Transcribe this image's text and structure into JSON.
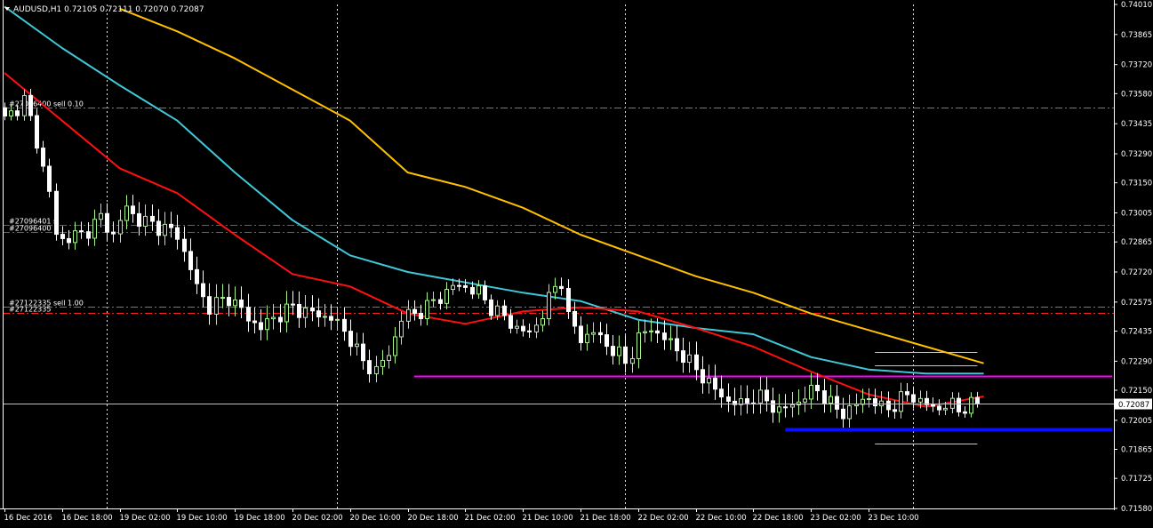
{
  "chart_data": {
    "type": "candlestick",
    "symbol_header": "AUDUSD,H1  0.72105 0.72111 0.72070 0.72087",
    "current_price": 0.72087,
    "current_price_label": "0.72087",
    "ylim": [
      0.7158,
      0.7401
    ],
    "y_ticks": [
      "0.74010",
      "0.73865",
      "0.73720",
      "0.73580",
      "0.73435",
      "0.73290",
      "0.73150",
      "0.73005",
      "0.72865",
      "0.72720",
      "0.72575",
      "0.72435",
      "0.72290",
      "0.72150",
      "0.72005",
      "0.71865",
      "0.71725",
      "0.71580"
    ],
    "x_range": [
      0,
      163
    ],
    "x_ticks": [
      {
        "i": 0,
        "label": "16 Dec 2016"
      },
      {
        "i": 9,
        "label": "16 Dec 18:00"
      },
      {
        "i": 18,
        "label": "19 Dec 02:00"
      },
      {
        "i": 27,
        "label": "19 Dec 10:00"
      },
      {
        "i": 36,
        "label": "19 Dec 18:00"
      },
      {
        "i": 45,
        "label": "20 Dec 02:00"
      },
      {
        "i": 54,
        "label": "20 Dec 10:00"
      },
      {
        "i": 63,
        "label": "20 Dec 18:00"
      },
      {
        "i": 72,
        "label": "21 Dec 02:00"
      },
      {
        "i": 81,
        "label": "21 Dec 10:00"
      },
      {
        "i": 90,
        "label": "21 Dec 18:00"
      },
      {
        "i": 99,
        "label": "22 Dec 02:00"
      },
      {
        "i": 108,
        "label": "22 Dec 10:00"
      },
      {
        "i": 117,
        "label": "22 Dec 18:00"
      },
      {
        "i": 126,
        "label": "23 Dec 02:00"
      },
      {
        "i": 135,
        "label": "23 Dec 10:00"
      }
    ],
    "period_separators": [
      16,
      52,
      97,
      142
    ],
    "close_anchors": [
      [
        0,
        0.7345
      ],
      [
        3,
        0.7355
      ],
      [
        5,
        0.7335
      ],
      [
        7,
        0.731
      ],
      [
        8,
        0.729
      ],
      [
        9,
        0.7288
      ],
      [
        12,
        0.729
      ],
      [
        15,
        0.7298
      ],
      [
        17,
        0.729
      ],
      [
        19,
        0.7303
      ],
      [
        21,
        0.7297
      ],
      [
        23,
        0.7295
      ],
      [
        25,
        0.7293
      ],
      [
        27,
        0.729
      ],
      [
        30,
        0.7265
      ],
      [
        32,
        0.7255
      ],
      [
        35,
        0.726
      ],
      [
        38,
        0.725
      ],
      [
        40,
        0.7245
      ],
      [
        42,
        0.725
      ],
      [
        45,
        0.7255
      ],
      [
        48,
        0.7252
      ],
      [
        51,
        0.725
      ],
      [
        54,
        0.724
      ],
      [
        56,
        0.7228
      ],
      [
        58,
        0.7225
      ],
      [
        60,
        0.7232
      ],
      [
        62,
        0.725
      ],
      [
        64,
        0.7252
      ],
      [
        66,
        0.7255
      ],
      [
        68,
        0.726
      ],
      [
        70,
        0.7265
      ],
      [
        72,
        0.7265
      ],
      [
        74,
        0.7262
      ],
      [
        76,
        0.7255
      ],
      [
        78,
        0.725
      ],
      [
        80,
        0.7245
      ],
      [
        82,
        0.7242
      ],
      [
        84,
        0.7252
      ],
      [
        86,
        0.7265
      ],
      [
        87,
        0.7268
      ],
      [
        88,
        0.725
      ],
      [
        90,
        0.724
      ],
      [
        92,
        0.7243
      ],
      [
        94,
        0.7237
      ],
      [
        96,
        0.7232
      ],
      [
        97,
        0.7228
      ],
      [
        99,
        0.724
      ],
      [
        101,
        0.7245
      ],
      [
        103,
        0.724
      ],
      [
        105,
        0.7235
      ],
      [
        107,
        0.7228
      ],
      [
        109,
        0.7222
      ],
      [
        111,
        0.7215
      ],
      [
        113,
        0.721
      ],
      [
        115,
        0.7208
      ],
      [
        117,
        0.7212
      ],
      [
        119,
        0.721
      ],
      [
        121,
        0.7205
      ],
      [
        123,
        0.7208
      ],
      [
        125,
        0.7212
      ],
      [
        127,
        0.7216
      ],
      [
        129,
        0.7208
      ],
      [
        131,
        0.7204
      ],
      [
        133,
        0.7208
      ],
      [
        135,
        0.7212
      ],
      [
        137,
        0.7206
      ],
      [
        139,
        0.7208
      ],
      [
        141,
        0.7213
      ],
      [
        143,
        0.721
      ],
      [
        145,
        0.7206
      ],
      [
        147,
        0.7208
      ],
      [
        149,
        0.7206
      ],
      [
        151,
        0.7208
      ],
      [
        152,
        0.72087
      ]
    ],
    "ma_series": [
      {
        "color": "#ffc000",
        "points": [
          [
            18,
            0.7399
          ],
          [
            27,
            0.7388
          ],
          [
            36,
            0.7375
          ],
          [
            45,
            0.736
          ],
          [
            54,
            0.7345
          ],
          [
            63,
            0.732
          ],
          [
            72,
            0.7313
          ],
          [
            81,
            0.7303
          ],
          [
            90,
            0.729
          ],
          [
            99,
            0.728
          ],
          [
            108,
            0.727
          ],
          [
            117,
            0.7262
          ],
          [
            126,
            0.7252
          ],
          [
            135,
            0.7244
          ],
          [
            144,
            0.7236
          ],
          [
            153,
            0.7228
          ]
        ]
      },
      {
        "color": "#40c8d8",
        "points": [
          [
            0,
            0.74
          ],
          [
            9,
            0.738
          ],
          [
            18,
            0.7362
          ],
          [
            27,
            0.7345
          ],
          [
            36,
            0.732
          ],
          [
            45,
            0.7297
          ],
          [
            54,
            0.728
          ],
          [
            63,
            0.7272
          ],
          [
            72,
            0.7267
          ],
          [
            81,
            0.7262
          ],
          [
            90,
            0.7258
          ],
          [
            99,
            0.7249
          ],
          [
            108,
            0.7245
          ],
          [
            117,
            0.7242
          ],
          [
            126,
            0.7231
          ],
          [
            135,
            0.7225
          ],
          [
            144,
            0.7223
          ],
          [
            153,
            0.7223
          ]
        ]
      },
      {
        "color": "#ff1010",
        "points": [
          [
            0,
            0.7368
          ],
          [
            9,
            0.7345
          ],
          [
            18,
            0.7322
          ],
          [
            27,
            0.731
          ],
          [
            36,
            0.729
          ],
          [
            45,
            0.7271
          ],
          [
            54,
            0.7265
          ],
          [
            63,
            0.7252
          ],
          [
            72,
            0.7247
          ],
          [
            81,
            0.7253
          ],
          [
            90,
            0.7255
          ],
          [
            99,
            0.7253
          ],
          [
            108,
            0.7245
          ],
          [
            117,
            0.7236
          ],
          [
            126,
            0.7224
          ],
          [
            135,
            0.7213
          ],
          [
            144,
            0.7207
          ],
          [
            153,
            0.7212
          ]
        ]
      }
    ],
    "order_lines": [
      {
        "price": 0.73513,
        "color": "#1fb534",
        "dash": "8,3,2,3",
        "label": "#27096400 sell 0.10"
      },
      {
        "price": 0.72948,
        "color": "#ff2020",
        "dash": "8,3,2,3",
        "label": "#27096401 s"
      },
      {
        "price": 0.72914,
        "color": "#ff2020",
        "dash": "8,3,2,3",
        "label": "#27096400 "
      },
      {
        "price": 0.72554,
        "color": "#1fb534",
        "dash": "8,3,2,3",
        "label": "#27122335 sell 1.00"
      },
      {
        "price": 0.72525,
        "color": "#ff2020",
        "dash": "8,3,2,3",
        "label": "#27122335"
      }
    ],
    "level_lines": [
      {
        "price": 0.72218,
        "i0": 64,
        "i1": 192,
        "color": "#ff00ff",
        "width": 2
      },
      {
        "price": 0.7196,
        "i0": 122,
        "i1": 188,
        "color": "#0a10ff",
        "width": 4
      },
      {
        "price": 0.72336,
        "i0": 136,
        "i1": 152,
        "color": "#c8c8c8",
        "width": 1
      },
      {
        "price": 0.72272,
        "i0": 136,
        "i1": 152,
        "color": "#c8c8c8",
        "width": 1
      },
      {
        "price": 0.71892,
        "i0": 136,
        "i1": 152,
        "color": "#c8c8c8",
        "width": 1
      }
    ],
    "grid": true,
    "bull_color": "#a7f28a",
    "bear_color": "#ffffff",
    "background": "#000000"
  }
}
